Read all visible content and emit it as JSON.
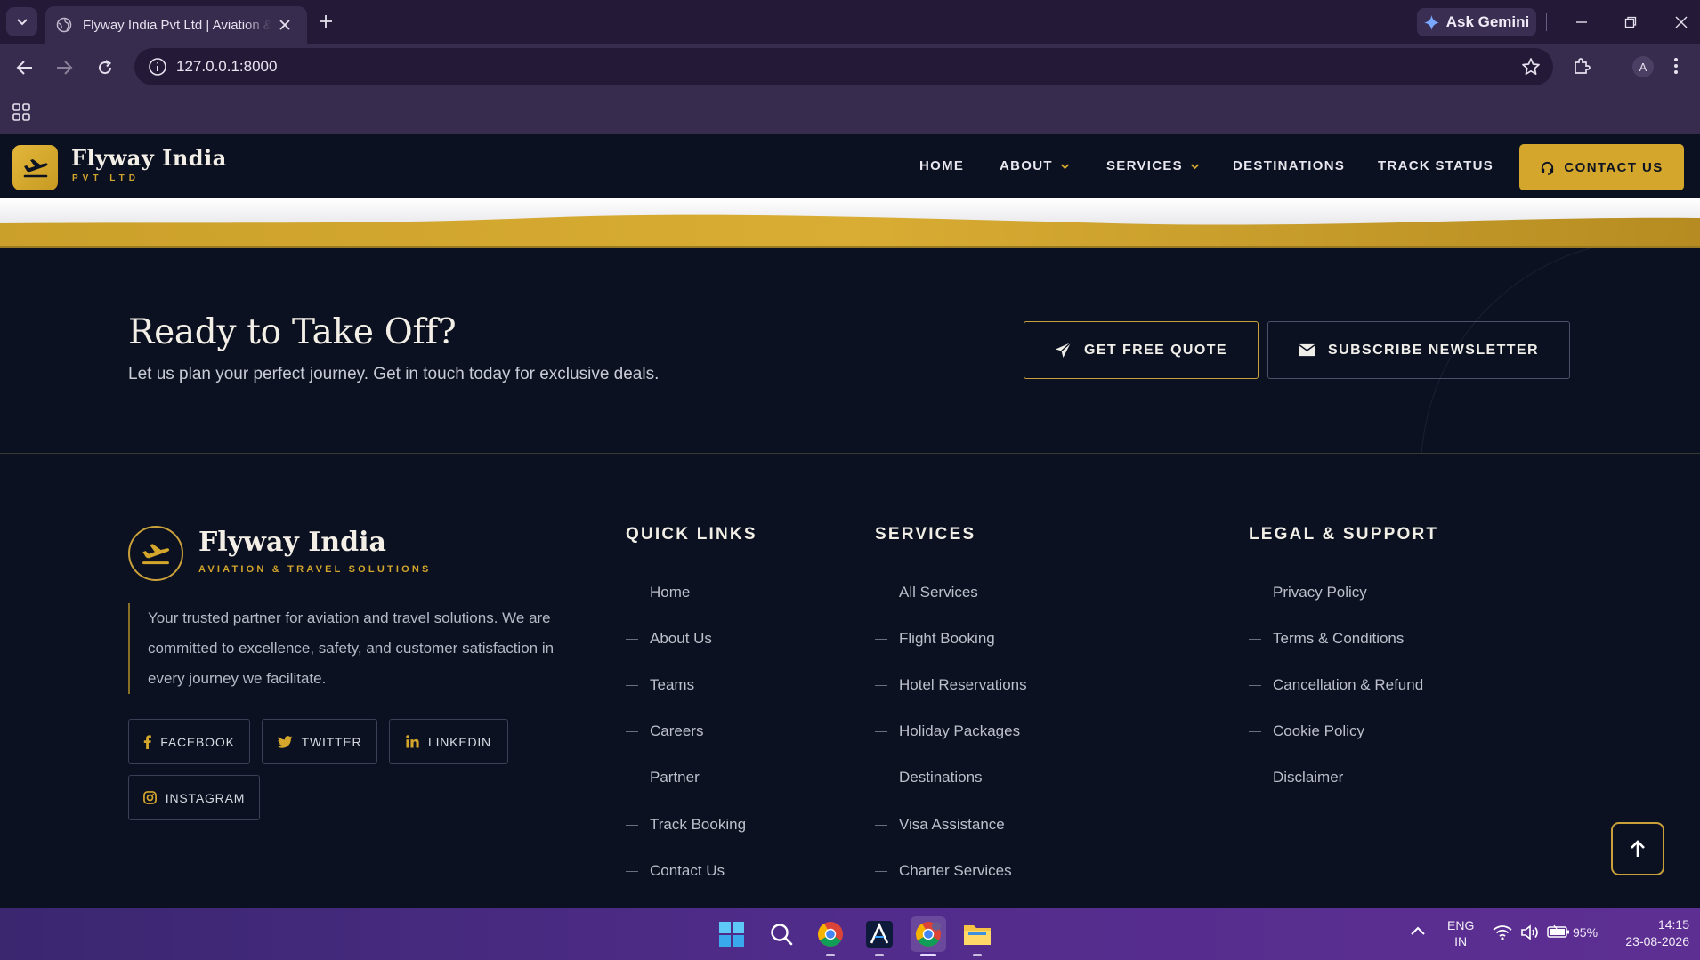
{
  "browser": {
    "tab_title": "Flyway India Pvt Ltd | Aviation & Travel",
    "url": "127.0.0.1:8000",
    "ask_gemini": "Ask Gemini",
    "profile_initial": "A"
  },
  "site": {
    "name": "Flyway India",
    "tagline": "PVT LTD",
    "nav": [
      "HOME",
      "ABOUT",
      "SERVICES",
      "DESTINATIONS",
      "TRACK STATUS"
    ],
    "contact_label": "CONTACT US"
  },
  "cta": {
    "title": "Ready to Take Off?",
    "subtitle": "Let us plan your perfect journey. Get in touch today for exclusive deals.",
    "quote_label": "GET FREE QUOTE",
    "newsletter_label": "SUBSCRIBE NEWSLETTER"
  },
  "footer": {
    "brand_name": "Flyway India",
    "brand_tagline": "AVIATION & TRAVEL SOLUTIONS",
    "description": "Your trusted partner for aviation and travel solutions. We are committed to excellence, safety, and customer satisfaction in every journey we facilitate.",
    "social": [
      "FACEBOOK",
      "TWITTER",
      "LINKEDIN",
      "INSTAGRAM"
    ],
    "quick_links": {
      "title": "QUICK LINKS",
      "items": [
        "Home",
        "About Us",
        "Teams",
        "Careers",
        "Partner",
        "Track Booking",
        "Contact Us"
      ]
    },
    "services": {
      "title": "SERVICES",
      "items": [
        "All Services",
        "Flight Booking",
        "Hotel Reservations",
        "Holiday Packages",
        "Destinations",
        "Visa Assistance",
        "Charter Services"
      ]
    },
    "legal": {
      "title": "LEGAL & SUPPORT",
      "items": [
        "Privacy Policy",
        "Terms & Conditions",
        "Cancellation & Refund",
        "Cookie Policy",
        "Disclaimer"
      ]
    }
  },
  "taskbar": {
    "lang_line1": "ENG",
    "lang_line2": "IN",
    "battery": "95%",
    "time": "14:15",
    "date": "23-08-2026"
  },
  "colors": {
    "accent_gold": "#d4a72c",
    "page_bg": "#0b1121",
    "browser_frame": "#382c4e"
  }
}
